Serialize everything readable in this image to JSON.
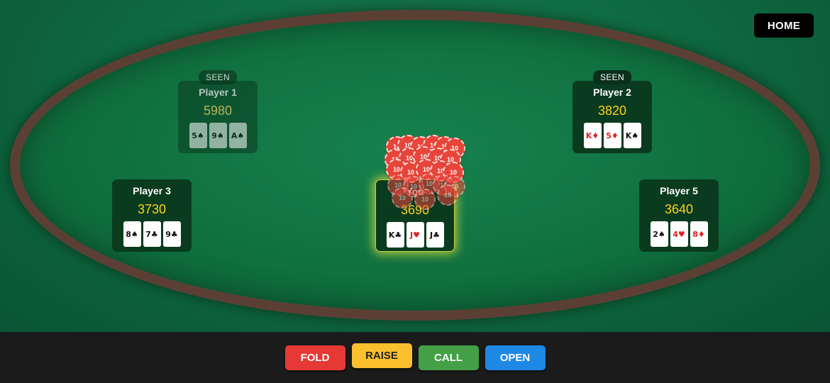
{
  "header": {
    "home_label": "HOME"
  },
  "players": [
    {
      "name": "Player 1",
      "chips": "5980",
      "status": "SEEN",
      "faded": true,
      "cards": [
        {
          "label": "5♠",
          "suit": "black"
        },
        {
          "label": "9♠",
          "suit": "black"
        },
        {
          "label": "A♠",
          "suit": "black"
        }
      ]
    },
    {
      "name": "Player 2",
      "chips": "3820",
      "status": "SEEN",
      "faded": false,
      "cards": [
        {
          "label": "K♦",
          "suit": "red"
        },
        {
          "label": "5♦",
          "suit": "red"
        },
        {
          "label": "K♠",
          "suit": "black"
        }
      ]
    },
    {
      "name": "Player 3",
      "chips": "3730",
      "status": "",
      "faded": false,
      "cards": [
        {
          "label": "8♠",
          "suit": "black"
        },
        {
          "label": "7♣",
          "suit": "black"
        },
        {
          "label": "9♣",
          "suit": "black"
        }
      ]
    },
    {
      "name": "You",
      "chips": "3690",
      "status": "",
      "faded": false,
      "cards": [
        {
          "label": "K♣",
          "suit": "black"
        },
        {
          "label": "J♥",
          "suit": "red"
        },
        {
          "label": "J♣",
          "suit": "black"
        }
      ]
    },
    {
      "name": "Player 5",
      "chips": "3640",
      "status": "",
      "faded": false,
      "cards": [
        {
          "label": "2♠",
          "suit": "black"
        },
        {
          "label": "4♥",
          "suit": "red"
        },
        {
          "label": "8♦",
          "suit": "red"
        }
      ]
    }
  ],
  "pot": {
    "chip_value": "10",
    "chip_count": 24,
    "chip_color": "#e8453a"
  },
  "actions": {
    "fold": "FOLD",
    "raise": "RAISE",
    "call": "CALL",
    "open": "OPEN"
  },
  "colors": {
    "felt": "#10703f",
    "rail": "#5b3f35",
    "chips_text": "#ffd21c",
    "bar": "#1b1b1b"
  }
}
